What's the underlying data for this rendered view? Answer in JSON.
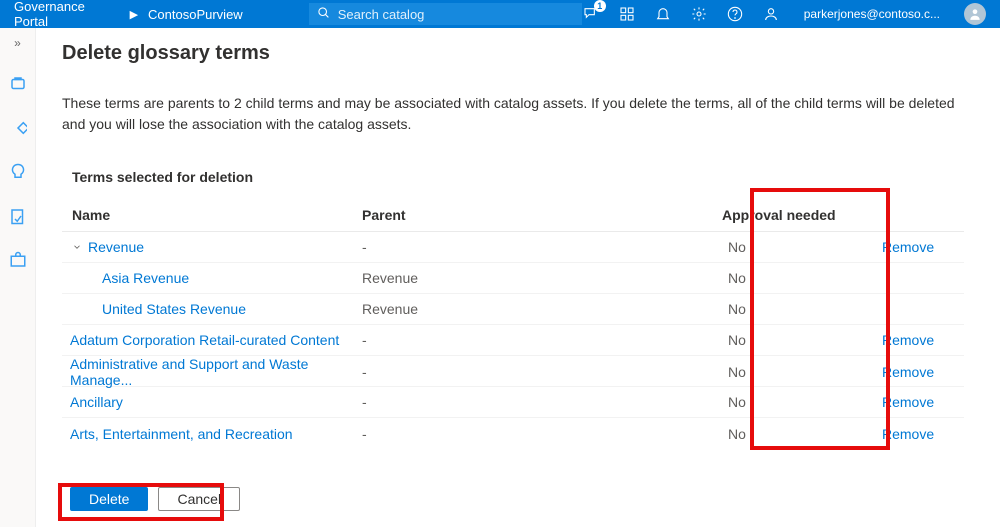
{
  "header": {
    "brand": "Governance Portal",
    "crumb": "ContosoPurview",
    "search_placeholder": "Search catalog",
    "notification_badge": "1",
    "user_email": "parkerjones@contoso.c..."
  },
  "page": {
    "title": "Delete glossary terms",
    "description": "These terms are parents to 2 child terms and may be associated with catalog assets. If you delete the terms, all of the child terms will be deleted and you will lose the association with the catalog assets.",
    "section_heading": "Terms selected for deletion"
  },
  "table": {
    "columns": {
      "name": "Name",
      "parent": "Parent",
      "approval": "Approval needed"
    },
    "rows": [
      {
        "name": "Revenue",
        "parent": "-",
        "approval": "No",
        "remove": "Remove",
        "level": 0,
        "expand": true
      },
      {
        "name": "Asia Revenue",
        "parent": "Revenue",
        "approval": "No",
        "remove": "",
        "level": 1,
        "expand": false
      },
      {
        "name": "United States Revenue",
        "parent": "Revenue",
        "approval": "No",
        "remove": "",
        "level": 1,
        "expand": false
      },
      {
        "name": "Adatum Corporation Retail-curated Content",
        "parent": "-",
        "approval": "No",
        "remove": "Remove",
        "level": 0,
        "expand": false
      },
      {
        "name": "Administrative and Support and Waste Manage...",
        "parent": "-",
        "approval": "No",
        "remove": "Remove",
        "level": 0,
        "expand": false
      },
      {
        "name": "Ancillary",
        "parent": "-",
        "approval": "No",
        "remove": "Remove",
        "level": 0,
        "expand": false
      },
      {
        "name": "Arts, Entertainment, and Recreation",
        "parent": "-",
        "approval": "No",
        "remove": "Remove",
        "level": 0,
        "expand": false
      }
    ]
  },
  "buttons": {
    "delete": "Delete",
    "cancel": "Cancel"
  }
}
